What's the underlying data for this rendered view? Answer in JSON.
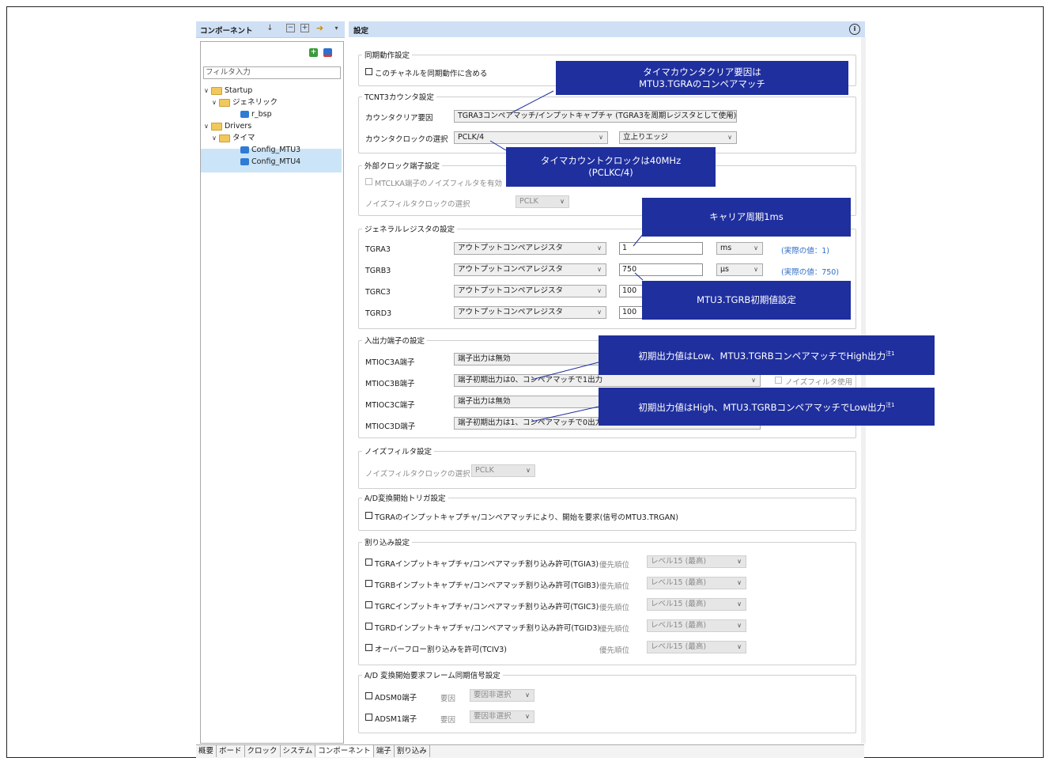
{
  "left_panel": {
    "title": "コンポーネント",
    "filter_placeholder": "フィルタ入力",
    "tree": [
      {
        "label": "Startup"
      },
      {
        "label": "ジェネリック"
      },
      {
        "label": "r_bsp"
      },
      {
        "label": "Drivers"
      },
      {
        "label": "タイマ"
      },
      {
        "label": "Config_MTU3"
      },
      {
        "label": "Config_MTU4"
      }
    ]
  },
  "right_panel": {
    "title": "設定"
  },
  "groups": {
    "sync": {
      "label": "同期動作設定",
      "checkbox": "このチャネルを同期動作に含める"
    },
    "tcnt": {
      "label": "TCNT3カウンタ設定",
      "clear_label": "カウンタクリア要因",
      "clear_value": "TGRA3コンペアマッチ/インプットキャプチャ (TGRA3を周期レジスタとして使用)",
      "clock_label": "カウンタクロックの選択",
      "clock_value": "PCLK/4",
      "edge_value": "立上りエッジ"
    },
    "ext": {
      "label": "外部クロック端子設定",
      "checkbox": "MTCLKA端子のノイズフィルタを有効",
      "nf_label": "ノイズフィルタクロックの選択",
      "nf_value": "PCLK"
    },
    "gen": {
      "label": "ジェネラルレジスタの設定",
      "rows": [
        {
          "name": "TGRA3",
          "type": "アウトプットコンペアレジスタ",
          "value": "1",
          "unit": "ms",
          "actual": "(実際の値：1)"
        },
        {
          "name": "TGRB3",
          "type": "アウトプットコンペアレジスタ",
          "value": "750",
          "unit": "μs",
          "actual": "(実際の値：750)"
        },
        {
          "name": "TGRC3",
          "type": "アウトプットコンペアレジスタ",
          "value": "100"
        },
        {
          "name": "TGRD3",
          "type": "アウトプットコンペアレジスタ",
          "value": "100"
        }
      ]
    },
    "io": {
      "label": "入出力端子の設定",
      "rows": [
        {
          "name": "MTIOC3A端子",
          "value": "端子出力は無効"
        },
        {
          "name": "MTIOC3B端子",
          "value": "端子初期出力は0、コンペアマッチで1出力",
          "filter": "ノイズフィルタ使用"
        },
        {
          "name": "MTIOC3C端子",
          "value": "端子出力は無効"
        },
        {
          "name": "MTIOC3D端子",
          "value": "端子初期出力は1、コンペアマッチで0出力"
        }
      ]
    },
    "nf": {
      "label": "ノイズフィルタ設定",
      "nf_label": "ノイズフィルタクロックの選択",
      "nf_value": "PCLK"
    },
    "ad": {
      "label": "A/D変換開始トリガ設定",
      "checkbox": "TGRAのインプットキャプチャ/コンペアマッチにより、開始を要求(信号のMTU3.TRGAN)"
    },
    "irq": {
      "label": "割り込み設定",
      "prio_label": "優先順位",
      "rows": [
        {
          "label": "TGRAインプットキャプチャ/コンペアマッチ割り込み許可(TGIA3)",
          "prio": "レベル15 (最高)"
        },
        {
          "label": "TGRBインプットキャプチャ/コンペアマッチ割り込み許可(TGIB3)",
          "prio": "レベル15 (最高)"
        },
        {
          "label": "TGRCインプットキャプチャ/コンペアマッチ割り込み許可(TGIC3)",
          "prio": "レベル15 (最高)"
        },
        {
          "label": "TGRDインプットキャプチャ/コンペアマッチ割り込み許可(TGID3)",
          "prio": "レベル15 (最高)"
        },
        {
          "label": "オーバーフロー割り込みを許可(TCIV3)",
          "prio": "レベル15 (最高)"
        }
      ]
    },
    "adsm": {
      "label": "A/D 変換開始要求フレーム同期信号設定",
      "factor_label": "要因",
      "rows": [
        {
          "label": "ADSM0端子",
          "value": "要因非選択"
        },
        {
          "label": "ADSM1端子",
          "value": "要因非選択"
        }
      ]
    }
  },
  "callouts": {
    "c1": {
      "line1": "タイマカウンタクリア要因は",
      "line2": "MTU3.TGRAのコンペアマッチ"
    },
    "c2": {
      "line1": "タイマカウントクロックは40MHz",
      "line2": "(PCLKC/4)"
    },
    "c3": {
      "line1": "キャリア周期1ms"
    },
    "c4": {
      "line1": "MTU3.TGRB初期値設定"
    },
    "c5": {
      "text": "初期出力値はLow、MTU3.TGRBコンペアマッチでHigh出力",
      "sup": "注1"
    },
    "c6": {
      "text": "初期出力値はHigh、MTU3.TGRBコンペアマッチでLow出力",
      "sup": "注1"
    }
  },
  "bottom_tabs": [
    "概要",
    "ボード",
    "クロック",
    "システム",
    "コンポーネント",
    "端子",
    "割り込み"
  ],
  "colors": {
    "callout_bg": "#1f2f9e",
    "header_bg": "#cfe0f5",
    "selection_bg": "#cce4f7",
    "note_blue": "#2f6fc7"
  }
}
